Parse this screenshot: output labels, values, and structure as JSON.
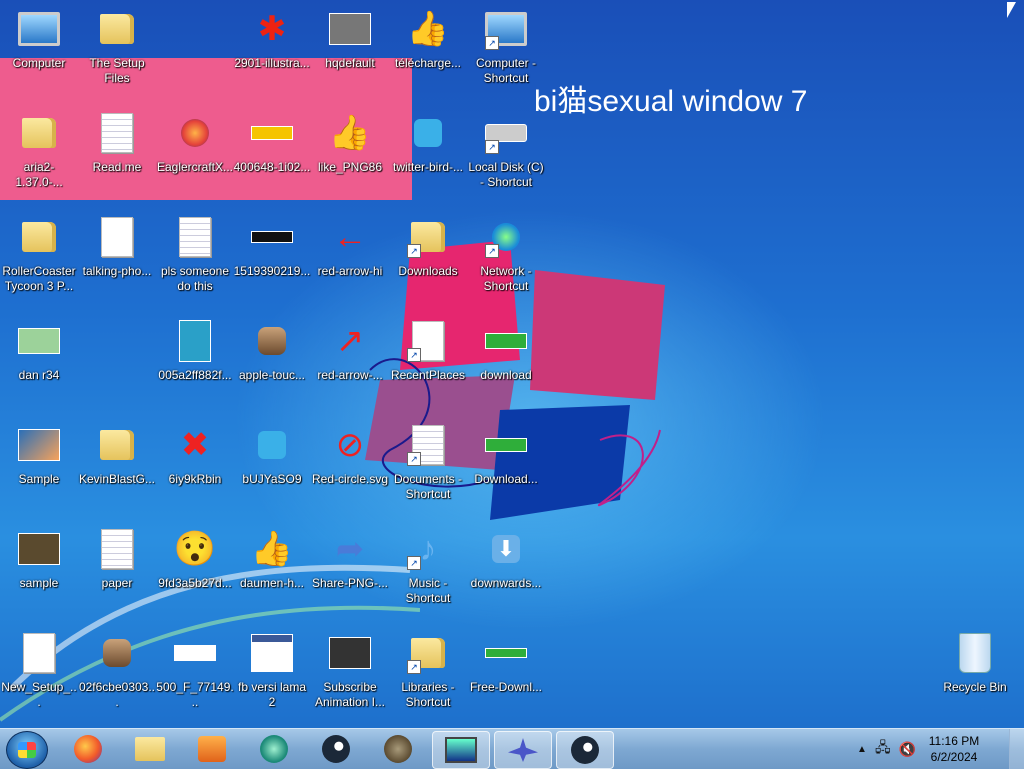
{
  "desktop": {
    "overlay_text": "bi猫sexual window 7",
    "icons": [
      {
        "label": "Computer"
      },
      {
        "label": "The Setup Files"
      },
      {
        "label": "2901-illustra..."
      },
      {
        "label": "hqdefault"
      },
      {
        "label": "télécharge..."
      },
      {
        "label": "Computer - Shortcut"
      },
      {
        "label": "aria2-1.37.0-..."
      },
      {
        "label": "Read.me"
      },
      {
        "label": "EaglercraftX..."
      },
      {
        "label": "400648-1i02..."
      },
      {
        "label": "like_PNG86"
      },
      {
        "label": "twitter-bird-..."
      },
      {
        "label": "Local Disk (C) - Shortcut"
      },
      {
        "label": "RollerCoaster Tycoon 3 P..."
      },
      {
        "label": "talking-pho..."
      },
      {
        "label": "pls someone do this"
      },
      {
        "label": "1519390219..."
      },
      {
        "label": "red-arrow-hi"
      },
      {
        "label": "Downloads"
      },
      {
        "label": "Network - Shortcut"
      },
      {
        "label": "dan r34"
      },
      {
        "label": "005a2ff882f..."
      },
      {
        "label": "apple-touc..."
      },
      {
        "label": "red-arrow-..."
      },
      {
        "label": "RecentPlaces"
      },
      {
        "label": "download"
      },
      {
        "label": "Sample"
      },
      {
        "label": "KevinBlastG..."
      },
      {
        "label": "6iy9kRbin"
      },
      {
        "label": "bUJYaSO9"
      },
      {
        "label": "Red-circle.svg"
      },
      {
        "label": "Documents - Shortcut"
      },
      {
        "label": "Download..."
      },
      {
        "label": "sample"
      },
      {
        "label": "paper"
      },
      {
        "label": "9fd3a5b27d..."
      },
      {
        "label": "daumen-h..."
      },
      {
        "label": "Share-PNG-..."
      },
      {
        "label": "Music - Shortcut"
      },
      {
        "label": "downwards..."
      },
      {
        "label": "New_Setup_..."
      },
      {
        "label": "02f6cbe0303..."
      },
      {
        "label": "500_F_77149..."
      },
      {
        "label": "fb versi lama 2"
      },
      {
        "label": "Subscribe Animation I..."
      },
      {
        "label": "Libraries - Shortcut"
      },
      {
        "label": "Free-Downl..."
      },
      {
        "label": "Recycle Bin"
      }
    ]
  },
  "taskbar": {
    "clock_time": "11:16 PM",
    "clock_date": "6/2/2024"
  }
}
